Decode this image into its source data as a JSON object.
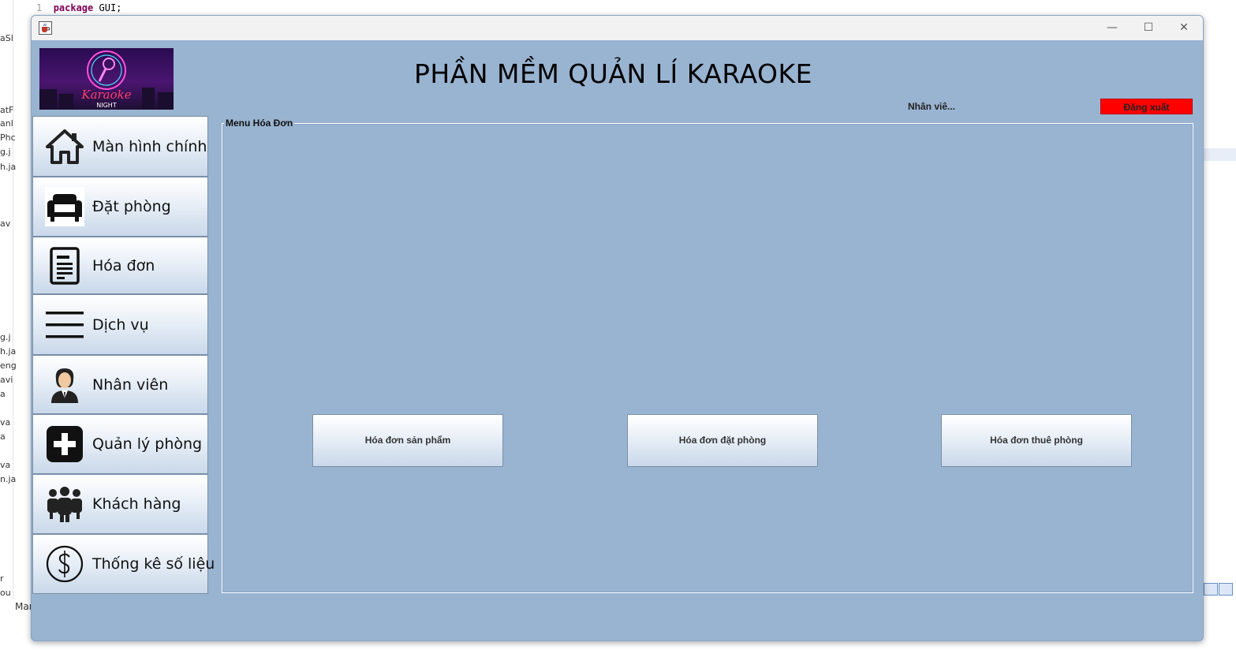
{
  "ide": {
    "line_number": "1",
    "code_keyword": "package",
    "code_rest": " GUI;",
    "side_fragments": [
      "aSl",
      "atF",
      "anl",
      "Phc",
      "g.j",
      "h.ja",
      "av",
      "g.j",
      "h.ja",
      "eng",
      "avi",
      "a",
      "va",
      "a",
      "va",
      "n.ja",
      "r",
      "ou"
    ],
    "bottom_tab": "Mar"
  },
  "window": {
    "title_bar_icon": "java-cup-icon",
    "controls": {
      "minimize": "—",
      "maximize": "☐",
      "close": "✕"
    }
  },
  "header": {
    "logo_text_top": "Karaoke",
    "logo_text_bottom": "NIGHT",
    "title": "PHẦN MỀM QUẢN LÍ KARAOKE",
    "user_label": "Nhân viê...",
    "logout_label": "Đăng xuất",
    "logout_color": "#ff0000"
  },
  "sidebar": {
    "items": [
      {
        "label": "Màn hình chính",
        "icon": "home-icon"
      },
      {
        "label": "Đặt phòng",
        "icon": "sofa-icon"
      },
      {
        "label": "Hóa đơn",
        "icon": "invoice-icon"
      },
      {
        "label": "Dịch vụ",
        "icon": "menu-lines-icon"
      },
      {
        "label": "Nhân viên",
        "icon": "employee-icon"
      },
      {
        "label": "Quản lý phòng",
        "icon": "plus-square-icon"
      },
      {
        "label": "Khách hàng",
        "icon": "customers-icon"
      },
      {
        "label": "Thống kê số liệu",
        "icon": "dollar-circle-icon"
      }
    ]
  },
  "main": {
    "panel_title": "Menu Hóa Đơn",
    "buttons": [
      {
        "label": "Hóa đơn sản phẩm"
      },
      {
        "label": "Hóa đơn đặt phòng"
      },
      {
        "label": "Hóa đơn thuê phòng"
      }
    ]
  },
  "colors": {
    "window_background": "#99b4d1",
    "button_gradient_top": "#ffffff",
    "button_gradient_bottom": "#c9d8ea"
  }
}
